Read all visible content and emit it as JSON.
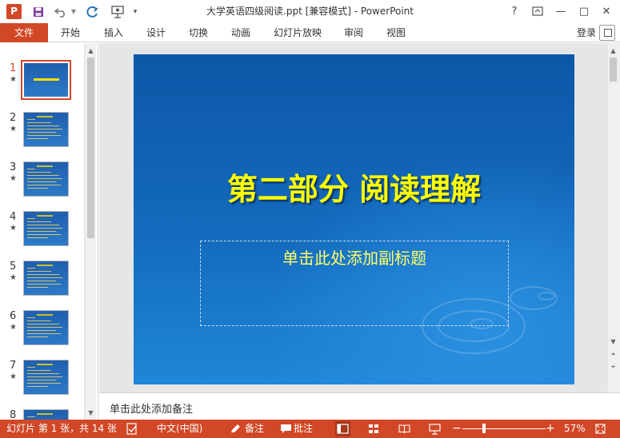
{
  "app": {
    "logo_letter": "P",
    "window_title": "大学英语四级阅读.ppt [兼容模式] - PowerPoint",
    "brand_color": "#d24726"
  },
  "window_controls": {
    "help": "?",
    "minimize": "—",
    "restore": "□",
    "close": "✕"
  },
  "ribbon": {
    "tabs": [
      "文件",
      "开始",
      "插入",
      "设计",
      "切换",
      "动画",
      "幻灯片放映",
      "审阅",
      "视图"
    ],
    "login": "登录"
  },
  "thumbnails": {
    "items": [
      {
        "number": "1",
        "star": "★"
      },
      {
        "number": "2",
        "star": "★"
      },
      {
        "number": "3",
        "star": "★"
      },
      {
        "number": "4",
        "star": "★"
      },
      {
        "number": "5",
        "star": "★"
      },
      {
        "number": "6",
        "star": "★"
      },
      {
        "number": "7",
        "star": "★"
      },
      {
        "number": "8",
        "star": ""
      }
    ],
    "selected_index": 0
  },
  "slide": {
    "title": "第二部分 阅读理解",
    "subtitle_placeholder": "单击此处添加副标题",
    "title_color": "#ffff00",
    "background_color": "#146bbd"
  },
  "notes": {
    "placeholder": "单击此处添加备注"
  },
  "statusbar": {
    "slide_info": "幻灯片 第 1 张，共 14 张",
    "language": "中文(中国)",
    "notes_label": "备注",
    "comments_label": "批注",
    "zoom_minus": "−",
    "zoom_plus": "+",
    "zoom_percent": "57%",
    "zoom_value": 57
  }
}
